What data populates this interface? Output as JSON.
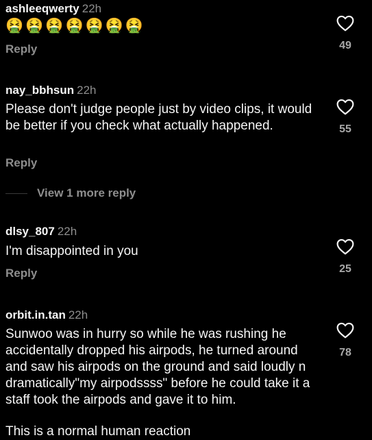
{
  "colors": {
    "background": "#000000",
    "text_primary": "#f5f5f5",
    "text_secondary": "#8e8e8e",
    "like_count": "#a8a8a8",
    "emoji": "#9bd34a"
  },
  "comments": [
    {
      "username": "ashleeqwerty",
      "time": "22h",
      "text": "🤮🤮🤮🤮🤮🤮🤮",
      "emoji_icon": "face-vomiting-emoji",
      "reply_label": "Reply",
      "like_icon": "heart-outline-icon",
      "likes": "49"
    },
    {
      "username": "nay_bbhsun",
      "time": "22h",
      "text": "Please don't judge people just by video clips, it would be better if you check what actually happened.",
      "reply_label": "Reply",
      "like_icon": "heart-outline-icon",
      "likes": "55",
      "view_replies_label": "View 1 more reply"
    },
    {
      "username": "dlsy_807",
      "time": "22h",
      "text": "I'm disappointed in you",
      "reply_label": "Reply",
      "like_icon": "heart-outline-icon",
      "likes": "25"
    },
    {
      "username": "orbit.in.tan",
      "time": "22h",
      "text": "Sunwoo was in hurry so while he was rushing he accidentally dropped his airpods, he turned around and saw his airpods on the ground and said loudly n dramatically\"my airpodssss\" before he could take it a staff took the airpods and gave it to him.",
      "text_2": "This is a normal human reaction",
      "like_icon": "heart-outline-icon",
      "likes": "78"
    }
  ]
}
